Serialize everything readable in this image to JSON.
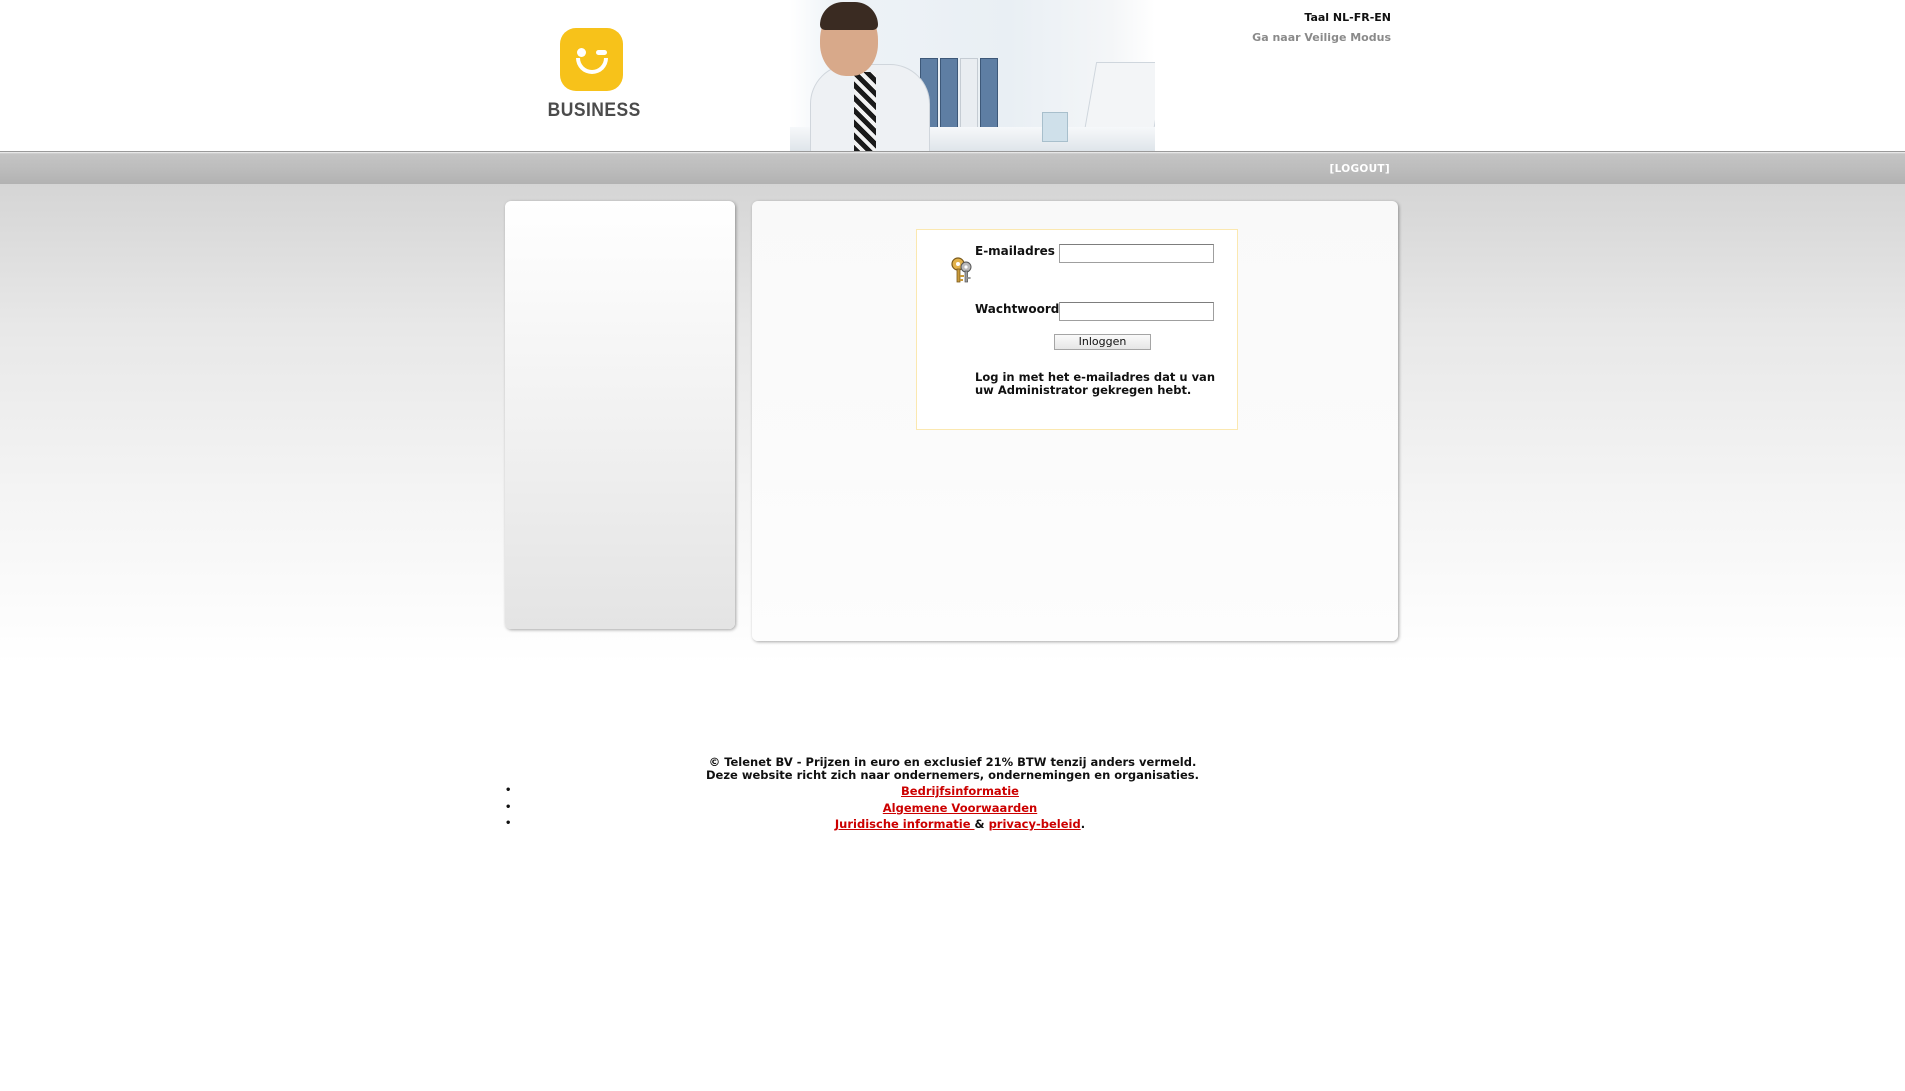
{
  "brand": {
    "logo_text": "BUSINESS",
    "accent_color": "#f7c21a",
    "icon": "smiley-logo-icon"
  },
  "header": {
    "language_label": "Taal",
    "languages": [
      "NL",
      "FR",
      "EN"
    ],
    "lang_separator": "-",
    "safe_mode_link": "Ga naar Veilige Modus"
  },
  "navbar": {
    "logout_label": "[LOGOUT]"
  },
  "login": {
    "email_label": "E-mailadres",
    "email_value": "",
    "password_label": "Wachtwoord",
    "password_value": "",
    "submit_label": "Inloggen",
    "hint": "Log in met het e-mailadres dat u van uw Administrator gekregen hebt.",
    "icon": "keys-icon"
  },
  "footer": {
    "copyright_line1": "© Telenet BV - Prijzen in euro en exclusief 21% BTW tenzij anders vermeld.",
    "copyright_line2": "Deze website richt zich naar ondernemers, ondernemingen en organisaties.",
    "link_company": "Bedrijfsinformatie",
    "link_terms": "Algemene Voorwaarden",
    "link_legal": "Juridische informatie ",
    "link_amp": "&",
    "link_privacy": "privacy-beleid",
    "link_dot": ".",
    "link_color": "#cc0000"
  }
}
